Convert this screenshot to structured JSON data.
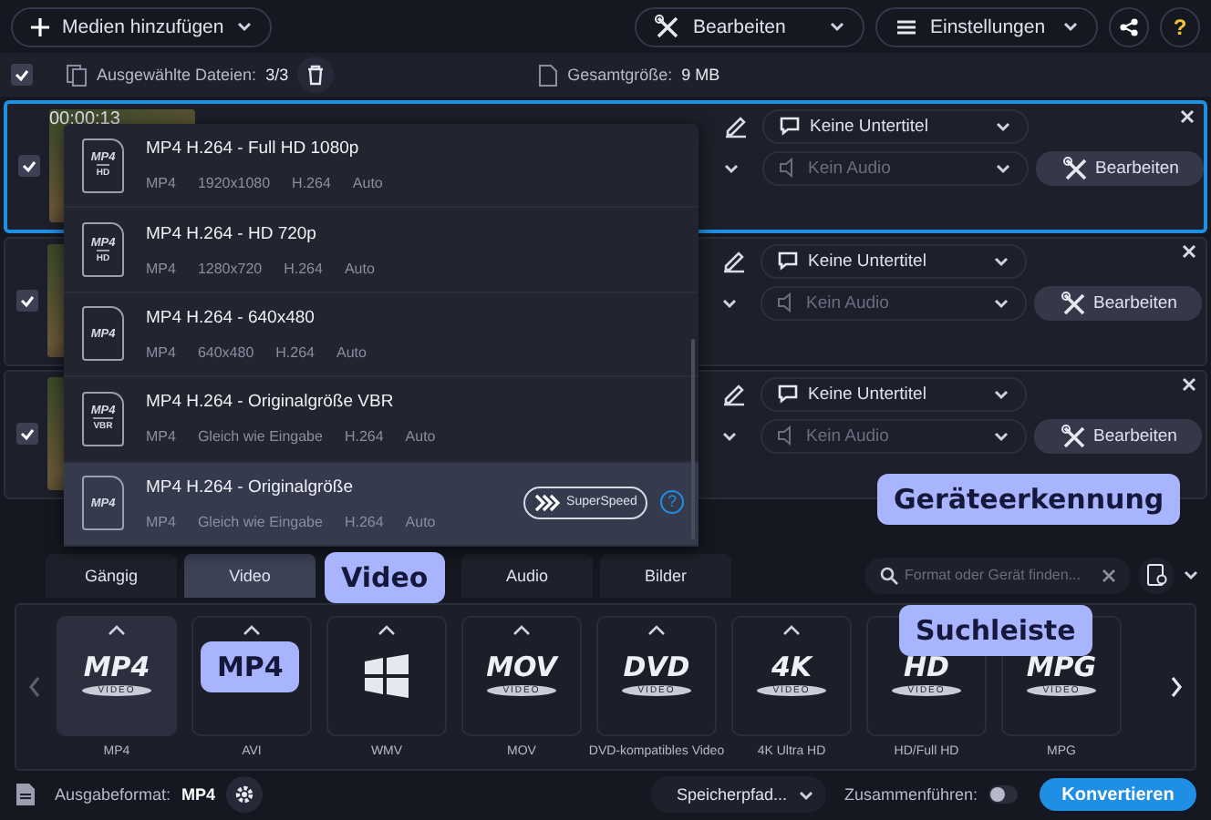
{
  "toolbar": {
    "add_media": "Medien hinzufügen",
    "edit": "Bearbeiten",
    "settings": "Einstellungen",
    "help": "?"
  },
  "selection_bar": {
    "checked": true,
    "selected_files_label": "Ausgewählte Dateien:",
    "selected_files_count": "3/3",
    "total_size_label": "Gesamtgröße:",
    "total_size": "9 MB"
  },
  "files": [
    {
      "duration": "00:00:13",
      "checked": true,
      "selected": true,
      "subtitle": "Keine Untertitel",
      "audio": "Kein Audio",
      "edit_button": "Bearbeiten"
    },
    {
      "checked": true,
      "selected": false,
      "subtitle": "Keine Untertitel",
      "audio": "Kein Audio",
      "edit_button": "Bearbeiten"
    },
    {
      "checked": true,
      "selected": false,
      "subtitle": "Keine Untertitel",
      "audio": "Kein Audio",
      "edit_button": "Bearbeiten"
    }
  ],
  "format_menu": {
    "presets": [
      {
        "title": "MP4 H.264 - Full HD 1080p",
        "icon_label": "MP4",
        "icon_badge": "HD",
        "specs": [
          "MP4",
          "1920x1080",
          "H.264",
          "Auto"
        ],
        "selected": false
      },
      {
        "title": "MP4 H.264 - HD 720p",
        "icon_label": "MP4",
        "icon_badge": "HD",
        "specs": [
          "MP4",
          "1280x720",
          "H.264",
          "Auto"
        ],
        "selected": false
      },
      {
        "title": "MP4 H.264 - 640x480",
        "icon_label": "MP4",
        "specs": [
          "MP4",
          "640x480",
          "H.264",
          "Auto"
        ],
        "selected": false
      },
      {
        "title": "MP4 H.264 - Originalgröße VBR",
        "icon_label": "MP4",
        "icon_badge": "VBR",
        "specs": [
          "MP4",
          "Gleich wie Eingabe",
          "H.264",
          "Auto"
        ],
        "selected": false
      },
      {
        "title": "MP4 H.264 - Originalgröße",
        "icon_label": "MP4",
        "specs": [
          "MP4",
          "Gleich wie Eingabe",
          "H.264",
          "Auto"
        ],
        "superspeed": "SuperSpeed",
        "help": "?",
        "selected": true
      }
    ]
  },
  "category_tabs": [
    {
      "label": "Gängig",
      "selected": false
    },
    {
      "label": "Video",
      "selected": true
    },
    {
      "label": "Audio",
      "selected": false
    },
    {
      "label": "Bilder",
      "selected": false
    }
  ],
  "search": {
    "placeholder": "Format oder Gerät finden..."
  },
  "formats": [
    {
      "kind": "text",
      "logo": "MP4",
      "logo_sub": "VIDEO",
      "label": "MP4",
      "selected": true
    },
    {
      "kind": "hidden",
      "label": "AVI",
      "selected": false
    },
    {
      "kind": "windows",
      "label": "WMV",
      "selected": false
    },
    {
      "kind": "text",
      "logo": "MOV",
      "logo_sub": "VIDEO",
      "label": "MOV",
      "selected": false
    },
    {
      "kind": "text",
      "logo": "DVD",
      "logo_sub": "VIDEO",
      "label": "DVD-kompatibles Video",
      "selected": false
    },
    {
      "kind": "text",
      "logo": "4K",
      "logo_sub": "VIDEO",
      "label": "4K Ultra HD",
      "selected": false
    },
    {
      "kind": "text",
      "logo": "HD",
      "logo_sub": "VIDEO",
      "label": "HD/Full HD",
      "selected": false
    },
    {
      "kind": "text",
      "logo": "MPG",
      "logo_sub": "VIDEO",
      "label": "MPG",
      "selected": false
    }
  ],
  "bottom_bar": {
    "output_format_label": "Ausgabeformat:",
    "output_format": "MP4",
    "save_path": "Speicherpfad...",
    "merge_label": "Zusammenführen:",
    "merge_on": false,
    "convert": "Konvertieren"
  },
  "callouts": [
    {
      "text": "Video"
    },
    {
      "text": "MP4"
    },
    {
      "text": "Geräteerkennung"
    },
    {
      "text": "Suchleiste"
    }
  ]
}
